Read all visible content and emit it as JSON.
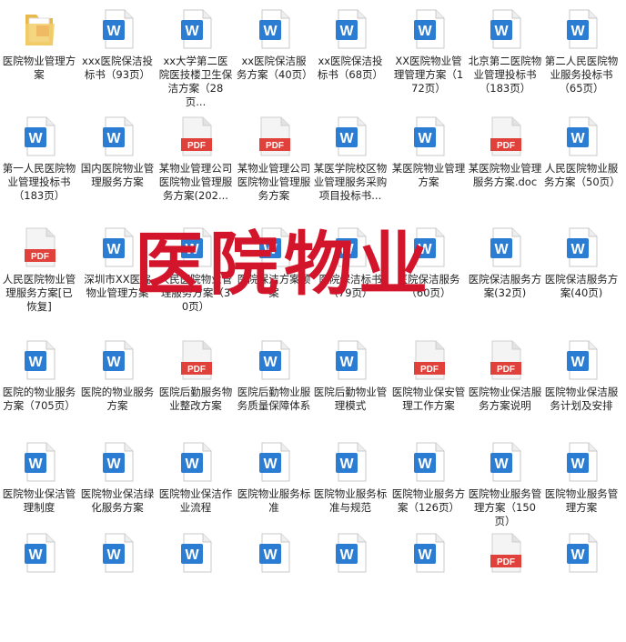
{
  "overlay_text": "医院物业",
  "rows": [
    [
      {
        "type": "folder",
        "label": "医院物业管理方案"
      },
      {
        "type": "word",
        "label": "xxx医院保洁投标书（93页）"
      },
      {
        "type": "word",
        "label": "xx大学第二医院医技楼卫生保洁方案（28页..."
      },
      {
        "type": "word",
        "label": "xx医院保洁服务方案（40页）"
      },
      {
        "type": "word",
        "label": "xx医院保洁投标书（68页）"
      },
      {
        "type": "word",
        "label": "XX医院物业管理管理方案（172页）"
      },
      {
        "type": "word",
        "label": "北京第二医院物业管理投标书（183页）"
      },
      {
        "type": "word",
        "label": "第二人民医院物业服务投标书（65页）"
      }
    ],
    [
      {
        "type": "word",
        "label": "第一人民医院物业管理投标书（183页）"
      },
      {
        "type": "word",
        "label": "国内医院物业管理服务方案"
      },
      {
        "type": "pdf",
        "label": "某物业管理公司医院物业管理服务方案(202..."
      },
      {
        "type": "pdf",
        "label": "某物业管理公司医院物业管理服务方案"
      },
      {
        "type": "word",
        "label": "某医学院校区物业管理服务采购项目投标书..."
      },
      {
        "type": "word",
        "label": "某医院物业管理方案"
      },
      {
        "type": "pdf",
        "label": "某医院物业管理服务方案.doc"
      },
      {
        "type": "word",
        "label": "人民医院物业服务方案（50页）"
      }
    ],
    [
      {
        "type": "pdf",
        "label": "人民医院物业管理服务方案[已恢复]"
      },
      {
        "type": "word",
        "label": "深圳市XX医院物业管理方案"
      },
      {
        "type": "word",
        "label": "人民医院物业管理服务方案（30页）"
      },
      {
        "type": "word",
        "label": "医院保洁方案预案"
      },
      {
        "type": "word",
        "label": "医院保洁标书（79页）"
      },
      {
        "type": "word",
        "label": "医院保洁服务（60页）"
      },
      {
        "type": "word",
        "label": "医院保洁服务方案(32页)"
      },
      {
        "type": "word",
        "label": "医院保洁服务方案(40页)"
      }
    ],
    [
      {
        "type": "word",
        "label": "医院的物业服务方案（705页）"
      },
      {
        "type": "word",
        "label": "医院的物业服务方案"
      },
      {
        "type": "pdf",
        "label": "医院后勤服务物业整改方案"
      },
      {
        "type": "word",
        "label": "医院后勤物业服务质量保障体系"
      },
      {
        "type": "word",
        "label": "医院后勤物业管理模式"
      },
      {
        "type": "pdf",
        "label": "医院物业保安管理工作方案"
      },
      {
        "type": "pdf",
        "label": "医院物业保洁服务方案说明"
      },
      {
        "type": "word",
        "label": "医院物业保洁服务计划及安排"
      }
    ],
    [
      {
        "type": "word",
        "label": "医院物业保洁管理制度"
      },
      {
        "type": "word",
        "label": "医院物业保洁绿化服务方案"
      },
      {
        "type": "word",
        "label": "医院物业保洁作业流程"
      },
      {
        "type": "word",
        "label": "医院物业服务标准"
      },
      {
        "type": "word",
        "label": "医院物业服务标准与规范"
      },
      {
        "type": "word",
        "label": "医院物业服务方案（126页）"
      },
      {
        "type": "word",
        "label": "医院物业服务管理方案（150页）"
      },
      {
        "type": "word",
        "label": "医院物业服务管理方案"
      }
    ],
    [
      {
        "type": "word",
        "label": ""
      },
      {
        "type": "word",
        "label": ""
      },
      {
        "type": "word",
        "label": ""
      },
      {
        "type": "word",
        "label": ""
      },
      {
        "type": "word",
        "label": ""
      },
      {
        "type": "word",
        "label": ""
      },
      {
        "type": "pdf",
        "label": ""
      },
      {
        "type": "word",
        "label": ""
      }
    ]
  ]
}
